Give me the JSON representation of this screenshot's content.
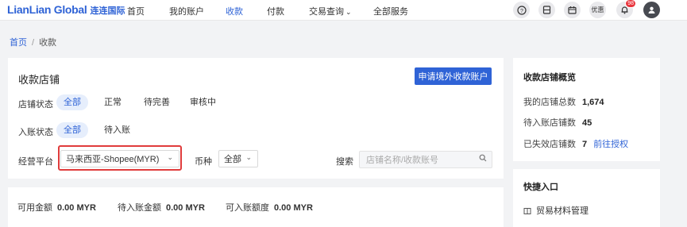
{
  "header": {
    "logo_en": "LianLian Global",
    "logo_cn": "连连国际",
    "nav": [
      {
        "label": "首页",
        "active": false
      },
      {
        "label": "我的账户",
        "active": false
      },
      {
        "label": "收款",
        "active": true
      },
      {
        "label": "付款",
        "active": false
      },
      {
        "label": "交易查询",
        "active": false,
        "has_dropdown": true
      },
      {
        "label": "全部服务",
        "active": false
      }
    ],
    "coupon_label": "优惠",
    "notification_count": "98",
    "icons": [
      "help-icon",
      "document-icon",
      "calendar-icon",
      "coupon-icon",
      "bell-icon",
      "user-icon"
    ]
  },
  "breadcrumb": {
    "home": "首页",
    "sep": "/",
    "current": "收款"
  },
  "main": {
    "title": "收款店铺",
    "apply_button": "申请境外收款账户",
    "store_status": {
      "label": "店铺状态",
      "options": [
        "全部",
        "正常",
        "待完善",
        "审核中"
      ],
      "selected": "全部"
    },
    "account_status": {
      "label": "入账状态",
      "options": [
        "全部",
        "待入账"
      ],
      "selected": "全部"
    },
    "platform": {
      "label": "经营平台",
      "value": "马来西亚-Shopee(MYR)"
    },
    "currency": {
      "label": "币种",
      "value": "全部"
    },
    "search": {
      "label": "搜索",
      "placeholder": "店铺名称/收款账号"
    }
  },
  "summary": [
    {
      "label": "可用金额",
      "value": "0.00 MYR"
    },
    {
      "label": "待入账金额",
      "value": "0.00 MYR"
    },
    {
      "label": "可入账额度",
      "value": "0.00 MYR"
    }
  ],
  "overview": {
    "title": "收款店铺概览",
    "total": {
      "label": "我的店铺总数",
      "value": "1,674"
    },
    "pending": {
      "label": "待入账店铺数",
      "value": "45"
    },
    "expired": {
      "label": "已失效店铺数",
      "value": "7",
      "link": "前往授权"
    }
  },
  "quick": {
    "title": "快捷入口",
    "items": [
      "贸易材料管理"
    ]
  },
  "colors": {
    "accent": "#2f63d6",
    "highlight": "#e03c3c"
  }
}
